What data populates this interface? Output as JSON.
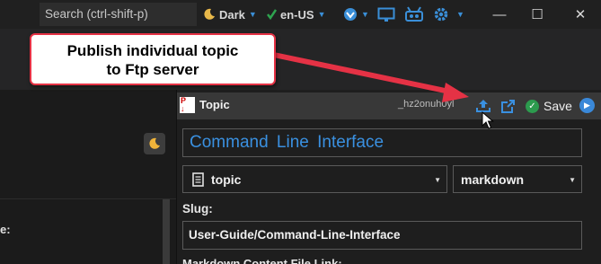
{
  "titlebar": {
    "search_placeholder": "Search (ctrl-shift-p)",
    "theme_label": "Dark",
    "language_label": "en-US",
    "icons": [
      "moon-icon",
      "flag-icon",
      "globe-icon",
      "monitor-icon",
      "presenter-icon",
      "gear-icon"
    ],
    "window_controls": {
      "minimize": "—",
      "maximize": "☐",
      "close": "✕"
    }
  },
  "callout": {
    "line1": "Publish individual topic",
    "line2": "to Ftp server",
    "border_color": "#e53245"
  },
  "left_panel": {
    "label_suffix": "e:",
    "fragment": "..."
  },
  "editor": {
    "header": {
      "doc_type": "Topic",
      "doc_id": "_hz2onuh0yl",
      "save_label": "Save",
      "icons": [
        "publish-icon",
        "open-external-icon",
        "check-icon",
        "chevron-right-icon"
      ]
    },
    "title_value": "Command  Line  Interface",
    "type_select": {
      "value": "topic"
    },
    "format_select": {
      "value": "markdown"
    },
    "slug_label": "Slug:",
    "slug_value": "User-Guide/Command-Line-Interface",
    "markdown_link_label": "Markdown Content File Link:"
  },
  "colors": {
    "accent_blue": "#3a90e0",
    "save_green": "#2c9b4e",
    "callout_red": "#e53245"
  }
}
